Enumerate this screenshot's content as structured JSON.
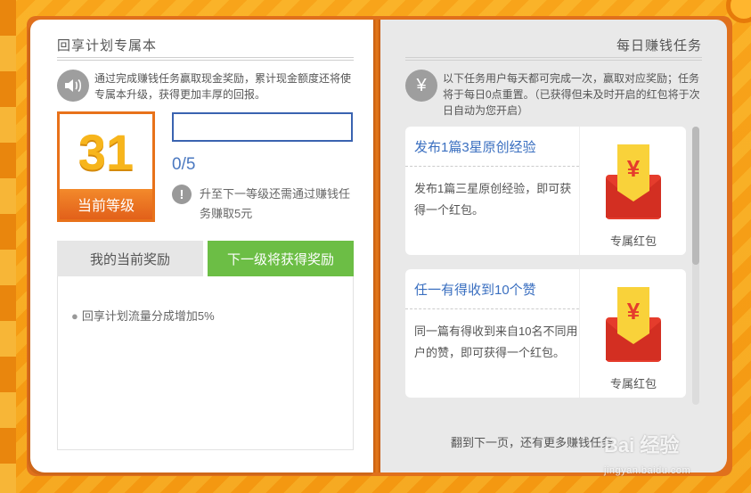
{
  "left_page": {
    "title": "回享计划专属本",
    "intro": "通过完成赚钱任务赢取现金奖励，累计现金额度还将使专属本升级，获得更加丰厚的回报。",
    "level_value": "31",
    "level_label": "当前等级",
    "progress_text": "0/5",
    "progress_fraction": 0,
    "upgrade_tip": "升至下一等级还需通过赚钱任务赚取5元",
    "tabs": {
      "current": "我的当前奖励",
      "next": "下一级将获得奖励"
    },
    "next_rewards": [
      "回享计划流量分成增加5%"
    ]
  },
  "right_page": {
    "title": "每日赚钱任务",
    "intro": "以下任务用户每天都可完成一次，赢取对应奖励；任务将于每日0点重置。（已获得但未及时开启的红包将于次日自动为您开启）",
    "tasks": [
      {
        "title": "发布1篇3星原创经验",
        "desc": "发布1篇三星原创经验，即可获得一个红包。",
        "reward_label": "专属红包"
      },
      {
        "title": "任一有得收到10个赞",
        "desc": "同一篇有得收到来自10名不同用户的赞，即可获得一个红包。",
        "reward_label": "专属红包"
      }
    ],
    "footer_note": "翻到下一页，还有更多赚钱任务"
  },
  "watermark": {
    "brand": "Bai 经验",
    "url": "jingyan.baidu.com"
  },
  "colors": {
    "accent_orange": "#e8721a",
    "accent_green": "#6cbe45",
    "link_blue": "#3a6fc0",
    "gold": "#f7b51c",
    "envelope_red": "#e53c2c"
  },
  "icons": {
    "speaker": "speaker-icon",
    "yuan": "yuan-icon",
    "warning": "exclamation-icon",
    "red_envelope": "red-envelope-icon"
  }
}
